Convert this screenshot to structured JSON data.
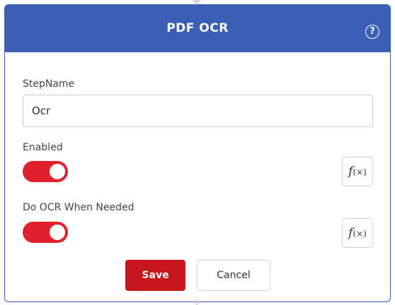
{
  "dialog": {
    "title": "PDF OCR",
    "help_icon": "help-circle-icon",
    "help_glyph": "?"
  },
  "fields": {
    "step_name": {
      "label": "StepName",
      "value": "Ocr"
    },
    "enabled": {
      "label": "Enabled",
      "checked": true
    },
    "do_ocr_when_needed": {
      "label": "Do OCR When Needed",
      "checked": true
    }
  },
  "expression_button": {
    "icon": "function-icon",
    "f_glyph": "f",
    "x_glyph": "(×)"
  },
  "actions": {
    "save_label": "Save",
    "cancel_label": "Cancel"
  },
  "colors": {
    "header": "#3a5fb5",
    "toggle_on": "#e0202d",
    "save_button": "#c8161d"
  }
}
